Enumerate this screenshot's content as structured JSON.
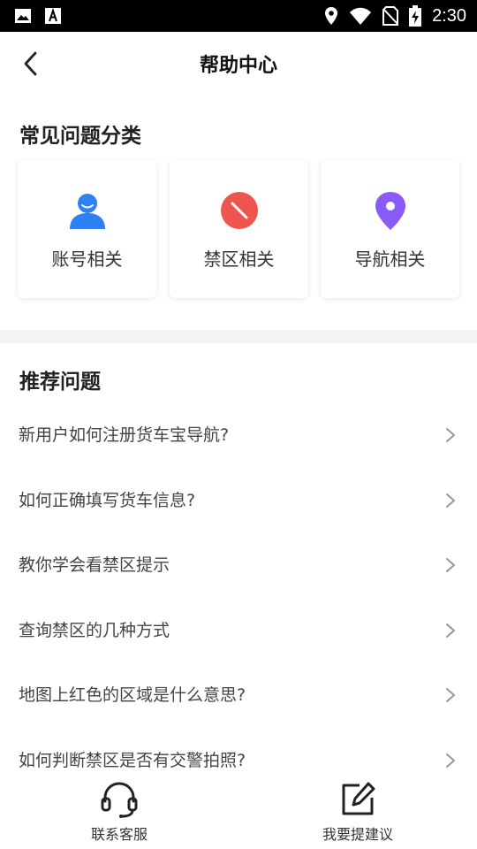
{
  "status_bar": {
    "time": "2:30",
    "left_icons": [
      "image-icon",
      "text-a-icon"
    ],
    "right_icons": [
      "location-icon",
      "wifi-icon",
      "no-sim-icon",
      "battery-charging-icon"
    ]
  },
  "header": {
    "title": "帮助中心",
    "back_icon": "chevron-left-icon"
  },
  "categories": {
    "title": "常见问题分类",
    "items": [
      {
        "label": "账号相关",
        "icon": "user-icon",
        "color": "#2f7ff5"
      },
      {
        "label": "禁区相关",
        "icon": "no-entry-icon",
        "color": "#f0544f"
      },
      {
        "label": "导航相关",
        "icon": "map-pin-icon",
        "color": "#8a5cf5"
      }
    ]
  },
  "recommended": {
    "title": "推荐问题",
    "items": [
      {
        "label": "新用户如何注册货车宝导航?"
      },
      {
        "label": "如何正确填写货车信息?"
      },
      {
        "label": "教你学会看禁区提示"
      },
      {
        "label": "查询禁区的几种方式"
      },
      {
        "label": "地图上红色的区域是什么意思?"
      },
      {
        "label": "如何判断禁区是否有交警拍照?"
      }
    ]
  },
  "bottom_bar": {
    "items": [
      {
        "label": "联系客服",
        "icon": "headset-icon"
      },
      {
        "label": "我要提建议",
        "icon": "edit-icon"
      }
    ]
  }
}
